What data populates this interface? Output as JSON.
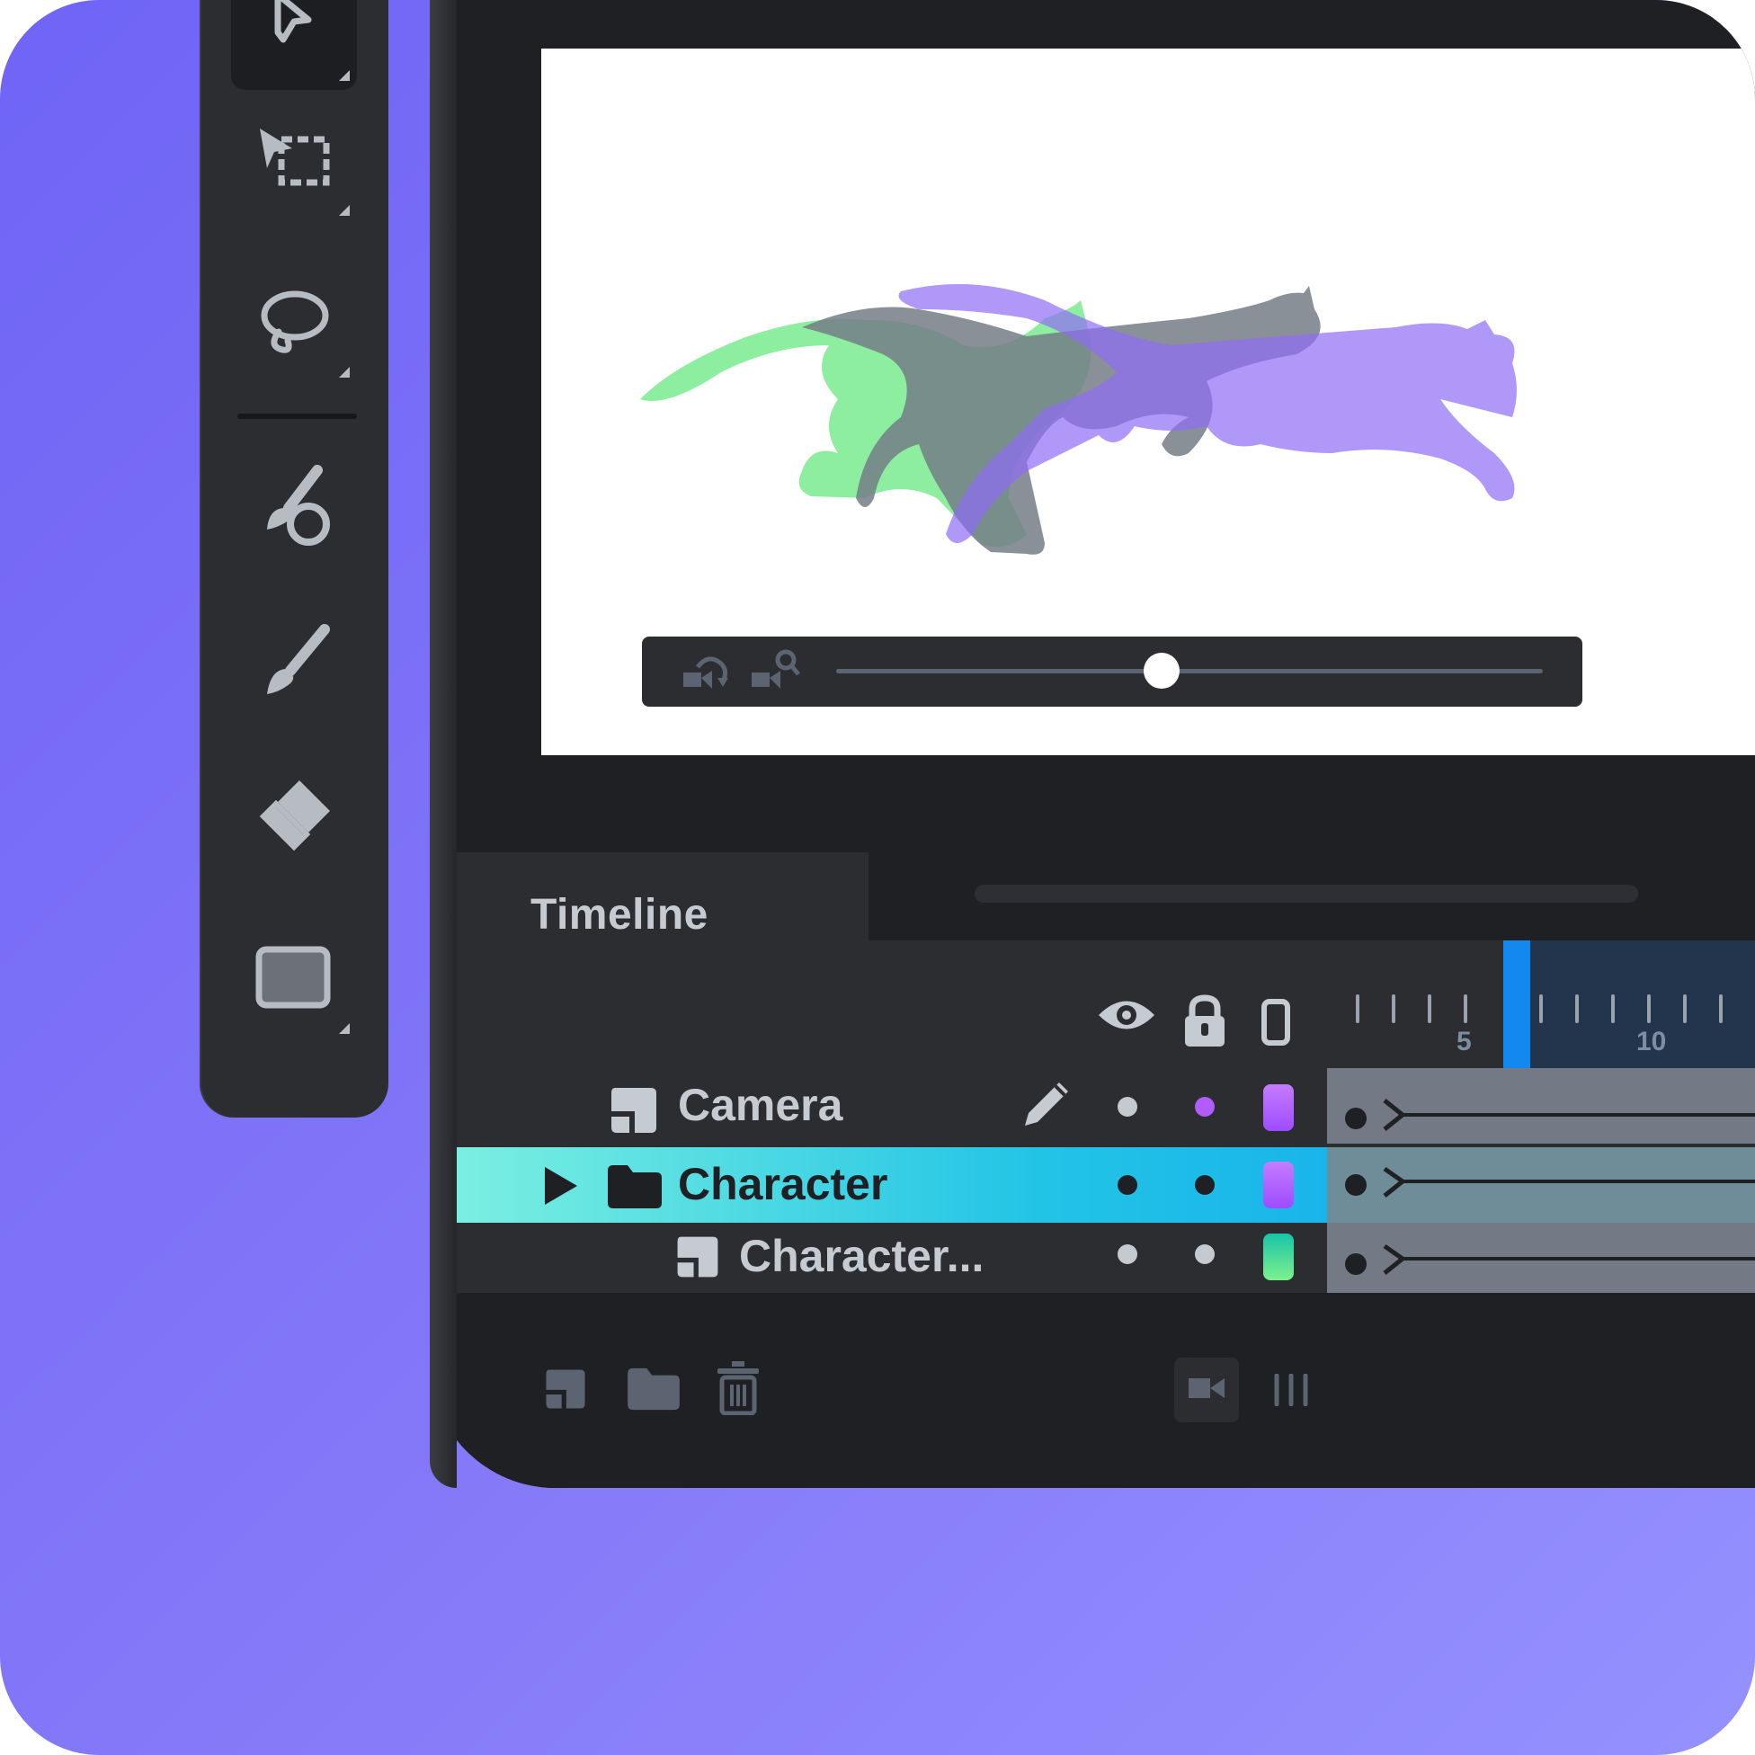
{
  "colors": {
    "background_gradient": [
      "#6f64f6",
      "#9591ff"
    ],
    "panel": "#2b2d31",
    "panel_dark": "#1f2023",
    "selection_gradient": [
      "#7ef1e0",
      "#0b9ef0"
    ],
    "playhead": "#1389f0",
    "cat_green": "#8cee9e",
    "cat_gray": "#747c86",
    "cat_purple": "#b197fa",
    "swatch_purple": "#b05cff",
    "swatch_teal": "#2ed6a8",
    "track": "#737a86"
  },
  "toolbar": {
    "tools": [
      {
        "icon": "selection-arrow-icon",
        "active": true
      },
      {
        "icon": "transform-icon",
        "active": false
      },
      {
        "icon": "lasso-icon",
        "active": false
      },
      {
        "icon": "brush-blend-icon",
        "active": false
      },
      {
        "icon": "brush-icon",
        "active": false
      },
      {
        "icon": "eraser-icon",
        "active": false
      },
      {
        "icon": "rectangle-icon",
        "active": false
      }
    ]
  },
  "player": {
    "icons": [
      "camera-rotate-icon",
      "camera-zoom-icon"
    ],
    "slider_value": 0.46
  },
  "timeline": {
    "title": "Timeline",
    "header_icons": [
      "eye-icon",
      "lock-icon",
      "outline-icon"
    ],
    "ruler_labels": [
      "5",
      "10"
    ],
    "playhead_frame": 6,
    "layers": [
      {
        "name": "Camera",
        "icon": "layer-icon",
        "editing": true,
        "visible_dot": "#c5cad0",
        "lock_dot": "#b05cff",
        "swatch": "purple",
        "selected": false
      },
      {
        "name": "Character",
        "icon": "folder-icon",
        "expander": "play-icon",
        "visible_dot": "#1f2023",
        "lock_dot": "#1f2023",
        "swatch": "purple",
        "selected": true
      },
      {
        "name": "Character...",
        "icon": "layer-icon",
        "visible_dot": "#c5cad0",
        "lock_dot": "#c5cad0",
        "swatch": "teal",
        "selected": false
      }
    ],
    "bottom_icons": [
      "new-layer-icon",
      "new-folder-icon",
      "trash-icon",
      "camera-icon",
      "columns-icon"
    ]
  }
}
